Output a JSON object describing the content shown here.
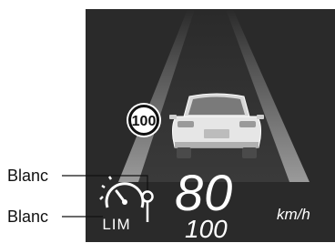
{
  "callouts": {
    "upper_label": "Blanc",
    "lower_label": "Blanc"
  },
  "display": {
    "speed_limit_sign": "100",
    "current_speed": "80",
    "set_limit_speed": "100",
    "unit": "km/h",
    "lim_icon_text": "LIM"
  },
  "colors": {
    "screen_background": "#2a2a2a",
    "display_text": "#ffffff",
    "callout_text": "#111111",
    "lane_marking": "#8a8a8a"
  }
}
